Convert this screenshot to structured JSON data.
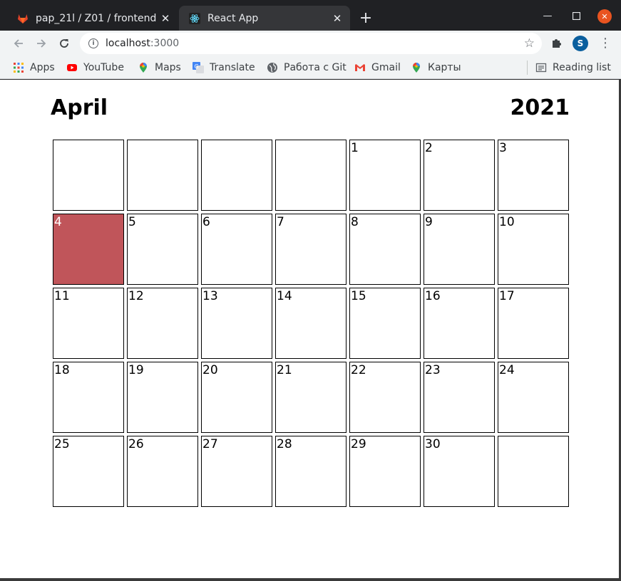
{
  "tabs": [
    {
      "title": "pap_21l / Z01 / frontend ·",
      "active": false,
      "icon": "gitlab-icon"
    },
    {
      "title": "React App",
      "active": true,
      "icon": "react-icon"
    }
  ],
  "toolbar": {
    "url_host": "localhost",
    "url_port": ":3000",
    "profile_initial": "S"
  },
  "bookmarks": [
    {
      "label": "Apps",
      "icon": "apps-grid-icon"
    },
    {
      "label": "YouTube",
      "icon": "youtube-icon"
    },
    {
      "label": "Maps",
      "icon": "maps-pin-icon"
    },
    {
      "label": "Translate",
      "icon": "translate-icon"
    },
    {
      "label": "Работа с Git",
      "icon": "globe-icon"
    },
    {
      "label": "Gmail",
      "icon": "gmail-icon"
    },
    {
      "label": "Карты",
      "icon": "maps-pin-icon"
    }
  ],
  "reading_list": "Reading list",
  "calendar": {
    "month": "April",
    "year": "2021",
    "highlight_color": "#c0555a",
    "today": "4",
    "days": [
      "",
      "",
      "",
      "",
      "1",
      "2",
      "3",
      "4",
      "5",
      "6",
      "7",
      "8",
      "9",
      "10",
      "11",
      "12",
      "13",
      "14",
      "15",
      "16",
      "17",
      "18",
      "19",
      "20",
      "21",
      "22",
      "23",
      "24",
      "25",
      "26",
      "27",
      "28",
      "29",
      "30",
      ""
    ]
  }
}
